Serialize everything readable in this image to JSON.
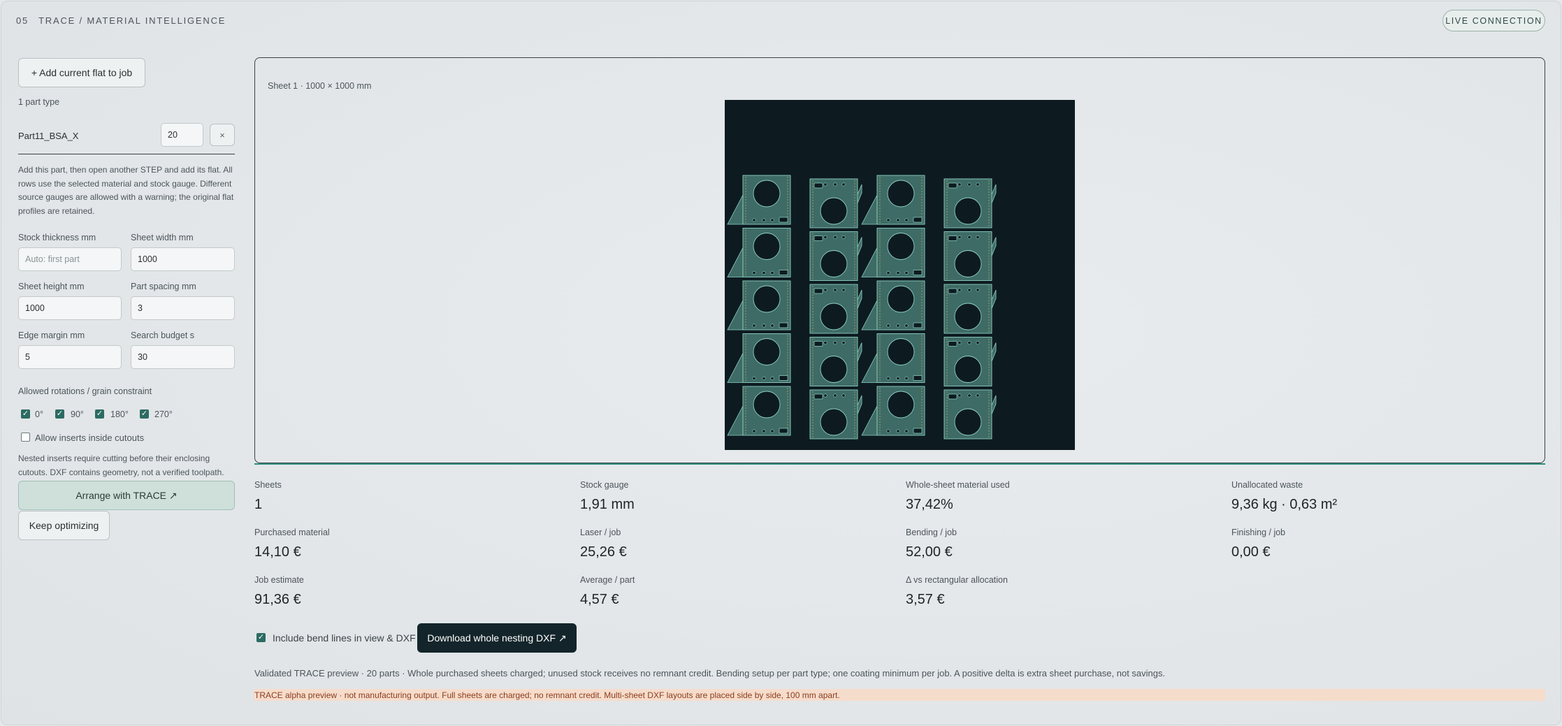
{
  "header": {
    "section_number": "05",
    "title": "TRACE / MATERIAL INTELLIGENCE",
    "live_button": "LIVE CONNECTION"
  },
  "sidebar": {
    "add_flat_button": "+ Add current flat to job",
    "part_type_count": "1 part type",
    "part": {
      "name": "Part11_BSA_X",
      "quantity": "20",
      "remove_symbol": "×"
    },
    "help_text": "Add this part, then open another STEP and add its flat. All rows use the selected material and stock gauge. Different source gauges are allowed with a warning; the original flat profiles are retained.",
    "fields": {
      "stock_thickness": {
        "label": "Stock thickness mm",
        "value": "",
        "placeholder": "Auto: first part"
      },
      "sheet_width": {
        "label": "Sheet width mm",
        "value": "1000"
      },
      "sheet_height": {
        "label": "Sheet height mm",
        "value": "1000"
      },
      "part_spacing": {
        "label": "Part spacing mm",
        "value": "3"
      },
      "edge_margin": {
        "label": "Edge margin mm",
        "value": "5"
      },
      "search_budget": {
        "label": "Search budget s",
        "value": "30"
      }
    },
    "rotations_label": "Allowed rotations / grain constraint",
    "rotations": [
      {
        "label": "0°",
        "checked": true
      },
      {
        "label": "90°",
        "checked": true
      },
      {
        "label": "180°",
        "checked": true
      },
      {
        "label": "270°",
        "checked": true
      }
    ],
    "allow_inserts": {
      "label": "Allow inserts inside cutouts",
      "checked": false
    },
    "inserts_note": "Nested inserts require cutting before their enclosing cutouts. DXF contains geometry, not a verified toolpath.",
    "arrange_button": "Arrange with TRACE ↗",
    "keep_optimizing_button": "Keep optimizing"
  },
  "sheet": {
    "caption": "Sheet 1 · 1000 × 1000 mm",
    "colors": {
      "background": "#0d1b21",
      "part_fill": "#3e6b66",
      "part_edge": "#8fd1c4",
      "bend_line": "#c7b45a"
    },
    "grid": {
      "rows": 5,
      "columns": 4,
      "parts_total": 20
    }
  },
  "stats": [
    {
      "label": "Sheets",
      "value": "1"
    },
    {
      "label": "Stock gauge",
      "value": "1,91 mm"
    },
    {
      "label": "Whole-sheet material used",
      "value": "37,42%"
    },
    {
      "label": "Unallocated waste",
      "value": "9,36 kg · 0,63 m²"
    },
    {
      "label": "Purchased material",
      "value": "14,10 €"
    },
    {
      "label": "Laser / job",
      "value": "25,26 €"
    },
    {
      "label": "Bending / job",
      "value": "52,00 €"
    },
    {
      "label": "Finishing / job",
      "value": "0,00 €"
    },
    {
      "label": "Job estimate",
      "value": "91,36 €"
    },
    {
      "label": "Average / part",
      "value": "4,57 €"
    },
    {
      "label": "Δ vs rectangular allocation",
      "value": "3,57 €"
    }
  ],
  "bend_lines": {
    "label": "Include bend lines in view & DXF",
    "checked": true
  },
  "download_button": "Download whole nesting DXF ↗",
  "footer_note": "Validated TRACE preview · 20 parts · Whole purchased sheets charged; unused stock receives no remnant credit. Bending setup per part type; one coating minimum per job. A positive delta is extra sheet purchase, not savings.",
  "warning": "TRACE alpha preview · not manufacturing output. Full sheets are charged; no remnant credit. Multi-sheet DXF layouts are placed side by side, 100 mm apart."
}
